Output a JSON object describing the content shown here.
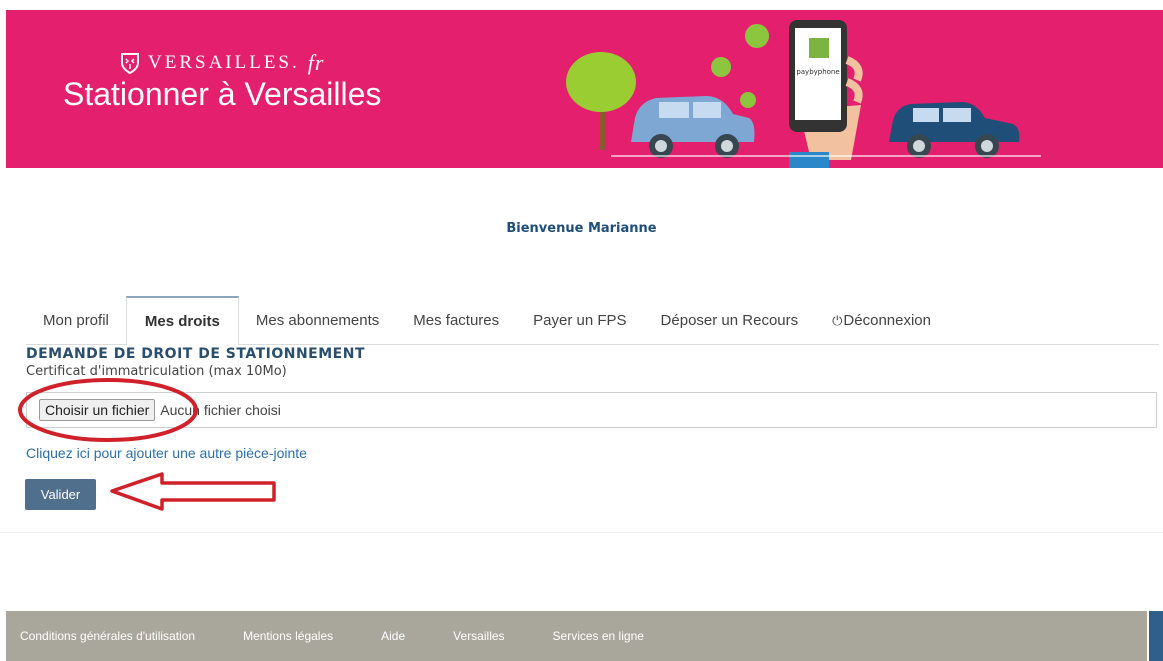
{
  "header": {
    "brand_name": "VERSAILLES.",
    "brand_suffix": "fr",
    "title": "Stationner à Versailles",
    "phone_label": "paybyphone",
    "colors": {
      "banner": "#e4206e"
    }
  },
  "welcome": "Bienvenue Marianne",
  "tabs": [
    {
      "label": "Mon profil",
      "active": false
    },
    {
      "label": "Mes droits",
      "active": true
    },
    {
      "label": "Mes abonnements",
      "active": false
    },
    {
      "label": "Mes factures",
      "active": false
    },
    {
      "label": "Payer un FPS",
      "active": false
    },
    {
      "label": "Déposer un Recours",
      "active": false
    },
    {
      "label": "Déconnexion",
      "active": false,
      "icon": "power-icon"
    }
  ],
  "form": {
    "title": "DEMANDE DE DROIT DE STATIONNEMENT",
    "file_label": "Certificat d'immatriculation (max 10Mo)",
    "file_button": "Choisir un fichier",
    "file_status": "Aucun fichier choisi",
    "add_attachment": "Cliquez ici pour ajouter une autre pièce-jointe",
    "submit": "Valider"
  },
  "footer": {
    "links": [
      "Conditions générales d'utilisation",
      "Mentions légales",
      "Aide",
      "Versailles",
      "Services en ligne"
    ]
  }
}
